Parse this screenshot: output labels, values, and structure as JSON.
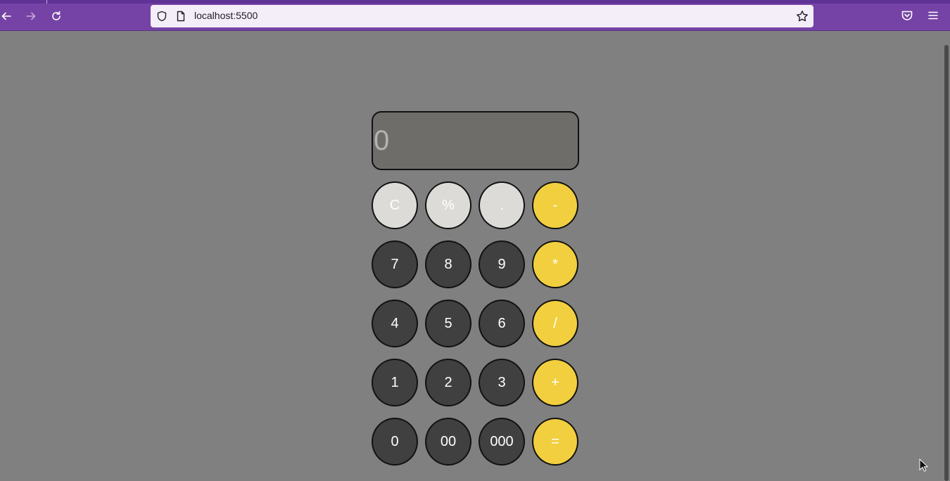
{
  "browser": {
    "url": "localhost:5500"
  },
  "calculator": {
    "display_value": "0",
    "keys": {
      "clear": "C",
      "percent": "%",
      "decimal": ".",
      "minus": "-",
      "seven": "7",
      "eight": "8",
      "nine": "9",
      "multiply": "*",
      "four": "4",
      "five": "5",
      "six": "6",
      "divide": "/",
      "one": "1",
      "two": "2",
      "three": "3",
      "plus": "+",
      "zero": "0",
      "double_zero": "00",
      "triple_zero": "000",
      "equals": "="
    }
  },
  "colors": {
    "browser_chrome": "#7543a6",
    "page_background": "#808080",
    "display_background": "#6e6d6a",
    "function_key": "#dcdbd8",
    "digit_key": "#404040",
    "operator_key": "#f2cf3f"
  },
  "icons": [
    "back-arrow-icon",
    "forward-arrow-icon",
    "reload-icon",
    "shield-icon",
    "page-icon",
    "star-icon",
    "pocket-icon",
    "hamburger-menu-icon"
  ]
}
